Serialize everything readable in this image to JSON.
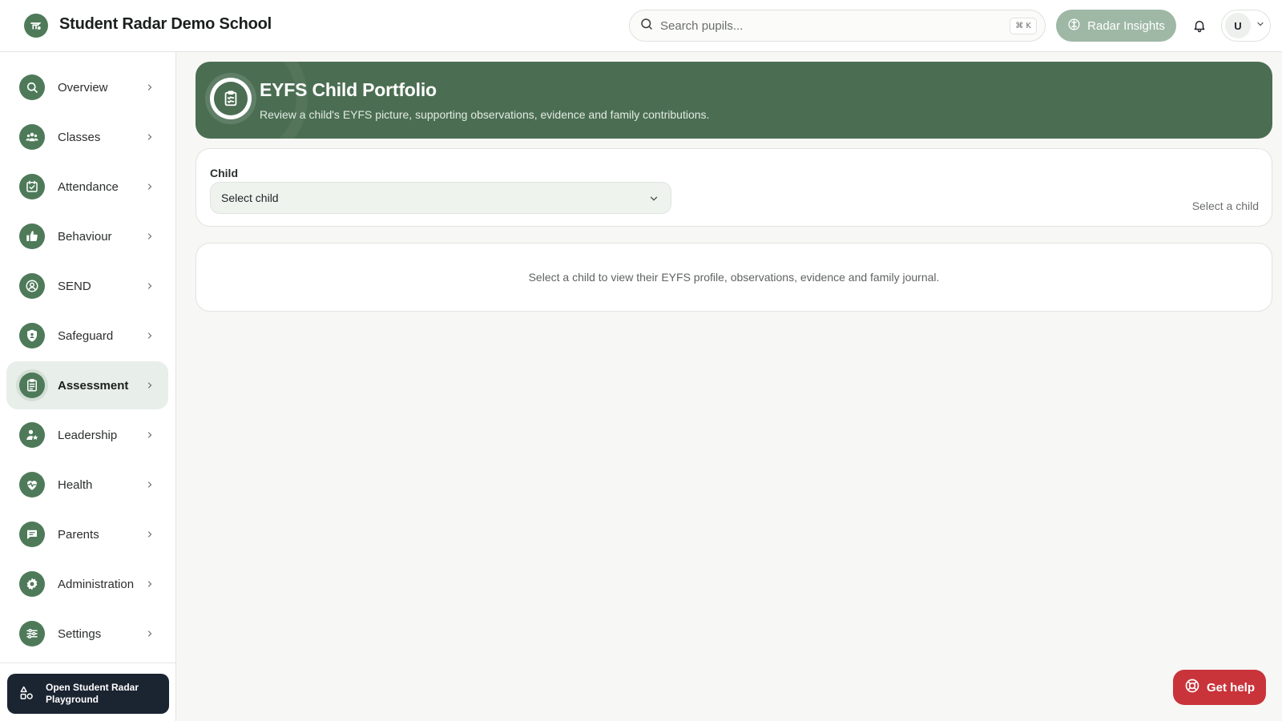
{
  "app": {
    "school_name": "Student Radar Demo School",
    "logo_icon": "radar-logo-icon",
    "brand_color": "#4e7a59"
  },
  "header": {
    "search": {
      "placeholder": "Search pupils...",
      "value": "",
      "shortcut": "⌘ K"
    },
    "insights_label": "Radar Insights",
    "user_initial": "U"
  },
  "sidebar": {
    "items": [
      {
        "label": "Overview",
        "icon": "search-icon"
      },
      {
        "label": "Classes",
        "icon": "users-icon"
      },
      {
        "label": "Attendance",
        "icon": "calendar-check-icon"
      },
      {
        "label": "Behaviour",
        "icon": "thumbs-up-icon"
      },
      {
        "label": "SEND",
        "icon": "user-circle-icon"
      },
      {
        "label": "Safeguard",
        "icon": "shield-icon"
      },
      {
        "label": "Assessment",
        "icon": "clipboard-icon",
        "active": true
      },
      {
        "label": "Leadership",
        "icon": "user-star-icon"
      },
      {
        "label": "Health",
        "icon": "heart-pulse-icon"
      },
      {
        "label": "Parents",
        "icon": "message-icon"
      },
      {
        "label": "Administration",
        "icon": "gear-icon"
      },
      {
        "label": "Settings",
        "icon": "sliders-icon"
      }
    ],
    "playground_label": "Open Student Radar Playground"
  },
  "main": {
    "banner": {
      "title": "EYFS Child Portfolio",
      "subtitle": "Review a child's EYFS picture, supporting observations, evidence and family contributions.",
      "color": "#4b6e52"
    },
    "child_selector": {
      "label": "Child",
      "selected": "Select child",
      "hint": "Select a child"
    },
    "empty_state": "Select a child to view their EYFS profile, observations, evidence and family journal."
  },
  "help": {
    "label": "Get help",
    "color": "#c9343a"
  }
}
